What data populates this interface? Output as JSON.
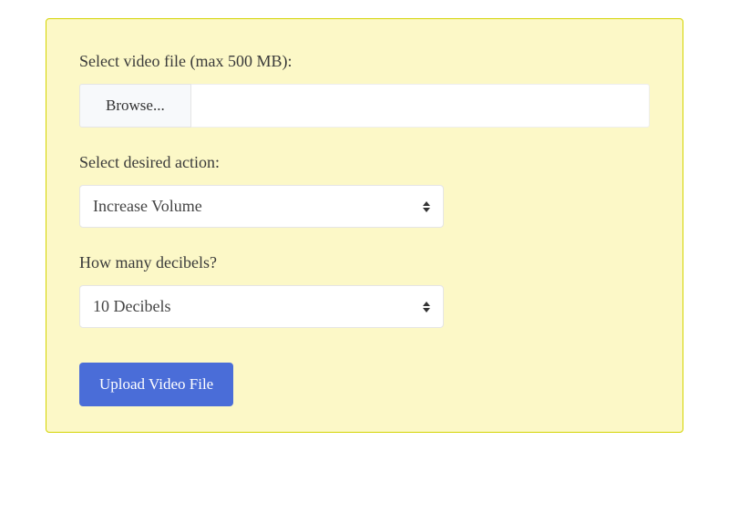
{
  "form": {
    "file_label": "Select video file (max 500 MB):",
    "browse_label": "Browse...",
    "file_value": "",
    "action_label": "Select desired action:",
    "action_selected": "Increase Volume",
    "decibels_label": "How many decibels?",
    "decibels_selected": "10 Decibels",
    "submit_label": "Upload Video File"
  }
}
